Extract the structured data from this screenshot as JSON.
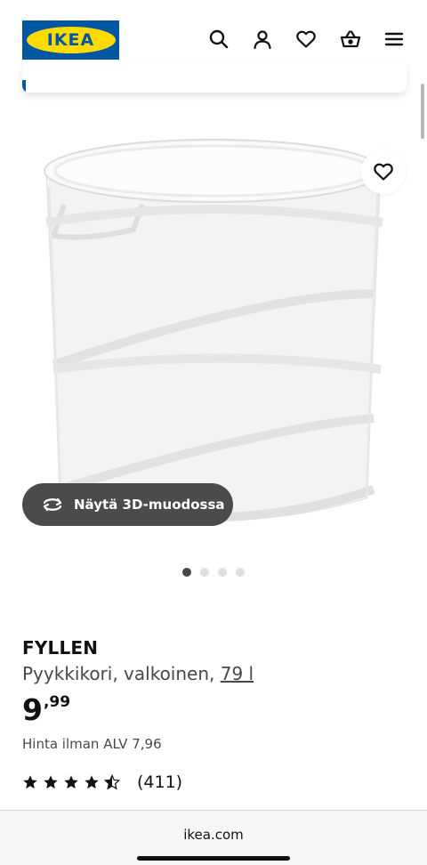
{
  "header": {
    "logo_text": "IKEA",
    "brand_colors": {
      "blue": "#0058a3",
      "yellow": "#ffdb00"
    },
    "icons": [
      "search-icon",
      "user-icon",
      "heart-icon",
      "basket-icon",
      "menu-icon"
    ]
  },
  "gallery": {
    "view_3d_label": "Näytä 3D-muodossa",
    "dots_total": 4,
    "dots_active_index": 0
  },
  "product": {
    "name": "FYLLEN",
    "description": "Pyykkikori, valkoinen,",
    "size_link": "79 l",
    "price_integer": "9",
    "price_decimal": ",99",
    "vat_text": "Hinta ilman ALV 7,96",
    "rating_value": 4.5,
    "rating_max": 5,
    "review_count": "(411)"
  },
  "browser": {
    "url": "ikea.com"
  }
}
